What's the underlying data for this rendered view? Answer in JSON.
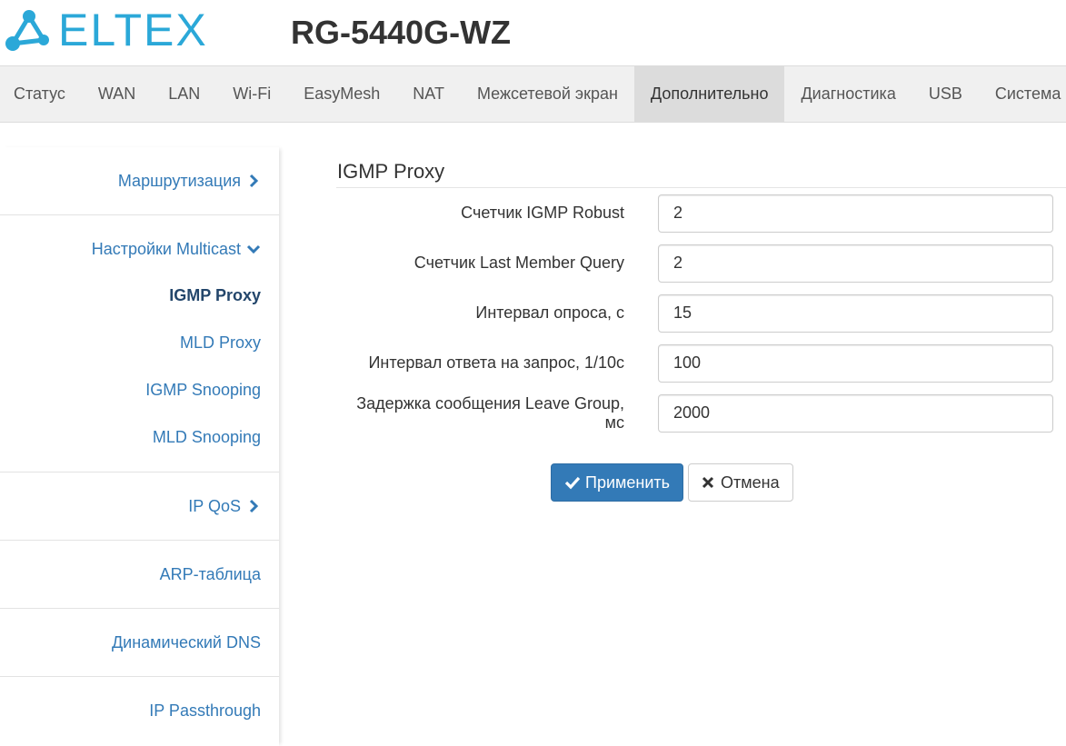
{
  "header": {
    "logo_text": "ELTEX",
    "device_model": "RG-5440G-WZ"
  },
  "topnav": {
    "items": [
      {
        "label": "Статус"
      },
      {
        "label": "WAN"
      },
      {
        "label": "LAN"
      },
      {
        "label": "Wi-Fi"
      },
      {
        "label": "EasyMesh"
      },
      {
        "label": "NAT"
      },
      {
        "label": "Межсетевой экран"
      },
      {
        "label": "Дополнительно",
        "active": true
      },
      {
        "label": "Диагностика"
      },
      {
        "label": "USB"
      },
      {
        "label": "Система"
      }
    ]
  },
  "sidebar": {
    "routing": "Маршрутизация",
    "multicast": "Настройки Multicast",
    "multicast_items": [
      "IGMP Proxy",
      "MLD Proxy",
      "IGMP Snooping",
      "MLD Snooping"
    ],
    "ipqos": "IP QoS",
    "arp": "ARP-таблица",
    "ddns": "Динамический DNS",
    "passthrough": "IP Passthrough"
  },
  "main": {
    "title": "IGMP Proxy",
    "fields": [
      {
        "label": "Счетчик IGMP Robust",
        "value": "2"
      },
      {
        "label": "Счетчик Last Member Query",
        "value": "2"
      },
      {
        "label": "Интервал опроса, с",
        "value": "15"
      },
      {
        "label": "Интервал ответа на запрос, 1/10с",
        "value": "100"
      },
      {
        "label": "Задержка сообщения Leave Group, мс",
        "value": "2000"
      }
    ],
    "apply_label": "Применить",
    "cancel_label": "Отмена"
  },
  "colors": {
    "brand": "#2ba8d8",
    "link": "#337ab7",
    "primary": "#337ab7"
  }
}
